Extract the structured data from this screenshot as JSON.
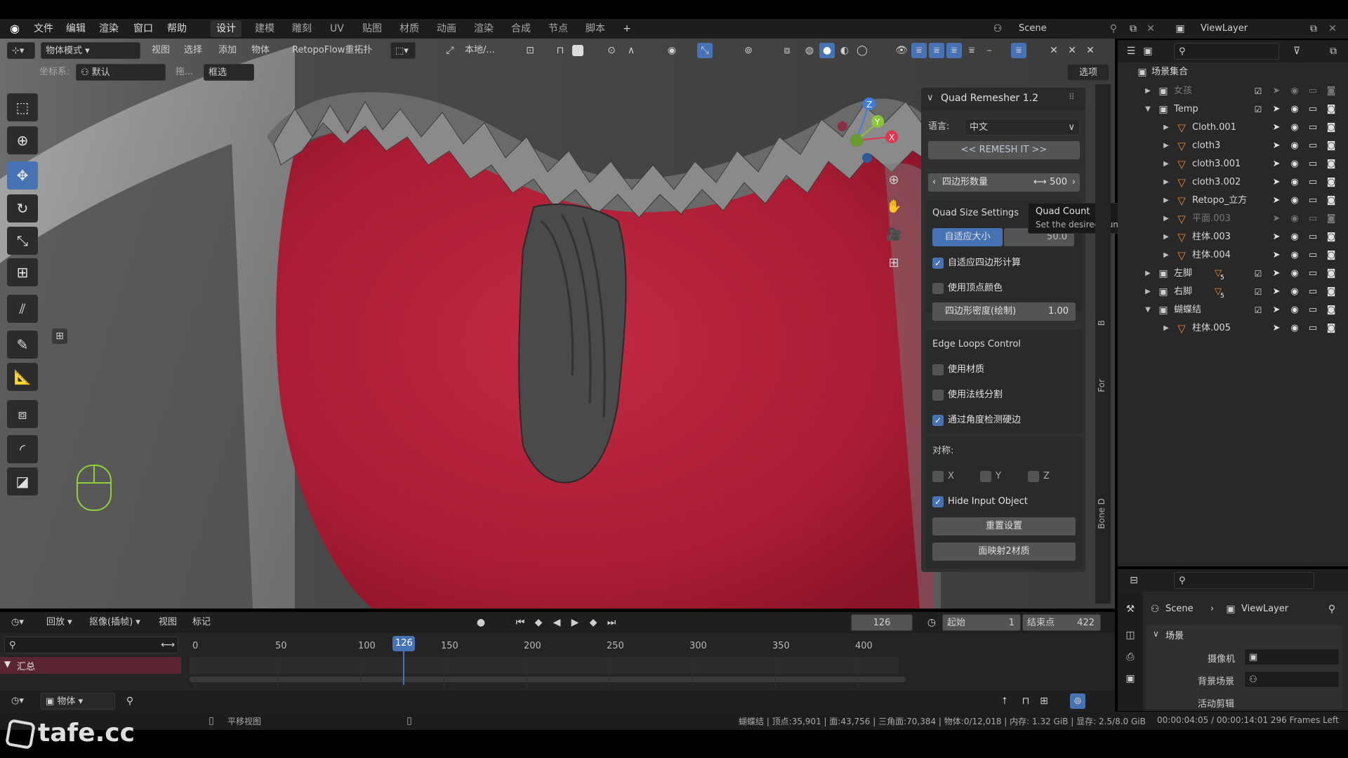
{
  "app": {
    "logo": "blender-logo-icon"
  },
  "menu": {
    "items": [
      "文件",
      "编辑",
      "渲染",
      "窗口",
      "帮助"
    ]
  },
  "workspace_tabs": [
    {
      "label": "设计",
      "active": true
    },
    {
      "label": "建模"
    },
    {
      "label": "雕刻"
    },
    {
      "label": "UV"
    },
    {
      "label": "贴图"
    },
    {
      "label": "材质"
    },
    {
      "label": "动画"
    },
    {
      "label": "渲染"
    },
    {
      "label": "合成"
    },
    {
      "label": "节点"
    },
    {
      "label": "脚本"
    }
  ],
  "scene_selector": {
    "value": "Scene"
  },
  "viewlayer_selector": {
    "value": "ViewLayer"
  },
  "header": {
    "mode": "物体模式",
    "menus": [
      "视图",
      "选择",
      "添加",
      "物体"
    ],
    "addon_menu": "RetopoFlow重拓扑",
    "transform_orientation": "本地/...",
    "coord_label": "坐标系:",
    "coord_value": "默认",
    "drag_label": "拖...",
    "drag_value": "框选",
    "options_label": "选项"
  },
  "tooltip": {
    "title": "Quad Count",
    "description": "Set the desired number of Quads."
  },
  "quad_remesher": {
    "title": "Quad Remesher 1.2",
    "language_label": "语言:",
    "language_value": "中文",
    "remesh_button": "<< REMESH IT >>",
    "quad_count_label": "四边形数量",
    "quad_count_value": "500",
    "size_settings_title": "Quad Size Settings",
    "adaptive_size_label": "自适应大小",
    "adaptive_size_value": "50.0",
    "adaptive_quad_count": {
      "label": "自适应四边形计算",
      "checked": true
    },
    "use_vertex_color": {
      "label": "使用顶点颜色",
      "checked": false
    },
    "density_label": "四边形密度(绘制)",
    "density_value": "1.00",
    "edge_loops_title": "Edge Loops Control",
    "use_materials": {
      "label": "使用材质",
      "checked": false
    },
    "use_normals": {
      "label": "使用法线分割",
      "checked": false
    },
    "detect_hard_edges": {
      "label": "通过角度检测硬边",
      "checked": true
    },
    "symmetry_label": "对称:",
    "sym_x": {
      "label": "X",
      "checked": false
    },
    "sym_y": {
      "label": "Y",
      "checked": false
    },
    "sym_z": {
      "label": "Z",
      "checked": false
    },
    "hide_input": {
      "label": "Hide Input Object",
      "checked": true
    },
    "reset_button": "重置设置",
    "bake_button": "面映射2材质"
  },
  "side_tabs": [
    "B",
    "For",
    "Bone D"
  ],
  "outliner": {
    "root": "场景集合",
    "items": [
      {
        "name": "女孩",
        "type": "collection",
        "dimmed": true,
        "depth": 1
      },
      {
        "name": "Temp",
        "type": "collection",
        "depth": 1,
        "expanded": true
      },
      {
        "name": "Cloth.001",
        "type": "mesh",
        "depth": 2
      },
      {
        "name": "cloth3",
        "type": "mesh",
        "depth": 2
      },
      {
        "name": "cloth3.001",
        "type": "mesh",
        "depth": 2
      },
      {
        "name": "cloth3.002",
        "type": "mesh",
        "depth": 2
      },
      {
        "name": "Retopo_立方",
        "type": "mesh",
        "depth": 2
      },
      {
        "name": "平面.003",
        "type": "mesh",
        "depth": 2,
        "dimmed": true
      },
      {
        "name": "柱体.003",
        "type": "mesh",
        "depth": 2
      },
      {
        "name": "柱体.004",
        "type": "mesh",
        "depth": 2
      },
      {
        "name": "左脚",
        "type": "collection",
        "depth": 1,
        "badge": "5"
      },
      {
        "name": "右脚",
        "type": "collection",
        "depth": 1,
        "badge": "5"
      },
      {
        "name": "蝴蝶结",
        "type": "collection",
        "depth": 1,
        "expanded": true
      },
      {
        "name": "柱体.005",
        "type": "mesh",
        "depth": 2
      }
    ]
  },
  "properties": {
    "breadcrumb_scene": "Scene",
    "breadcrumb_layer": "ViewLayer",
    "section": "场景",
    "camera_label": "摄像机",
    "bg_scene_label": "背景场景",
    "active_clip_label": "活动剪辑"
  },
  "timeline": {
    "menus": [
      "回放",
      "抠像(插帧)",
      "视图",
      "标记"
    ],
    "current_frame": "126",
    "start_label": "起始",
    "start_value": "1",
    "end_label": "结束点",
    "end_value": "422",
    "ticks": [
      "0",
      "50",
      "100",
      "150",
      "200",
      "250",
      "300",
      "350",
      "400"
    ],
    "summary_label": "汇总",
    "frame_range": [
      0,
      422
    ]
  },
  "bottom_header": {
    "mode": "物体"
  },
  "status": {
    "hint": "平移视图",
    "stats": "蝴蝶结 | 顶点:35,901 | 面:43,756 | 三角面:70,384 | 物体:0/12,018 | 内存: 1.32 GiB | 显存: 2.5/8.0 GiB",
    "time": "00:00:04:05 / 00:00:14:01 296 Frames Left"
  },
  "watermark": "tafe.cc",
  "colors": {
    "accent": "#4772b3",
    "mesh_red": "#b32238",
    "bg_dark": "#1d1d1d",
    "panel": "#2a2a2a"
  }
}
